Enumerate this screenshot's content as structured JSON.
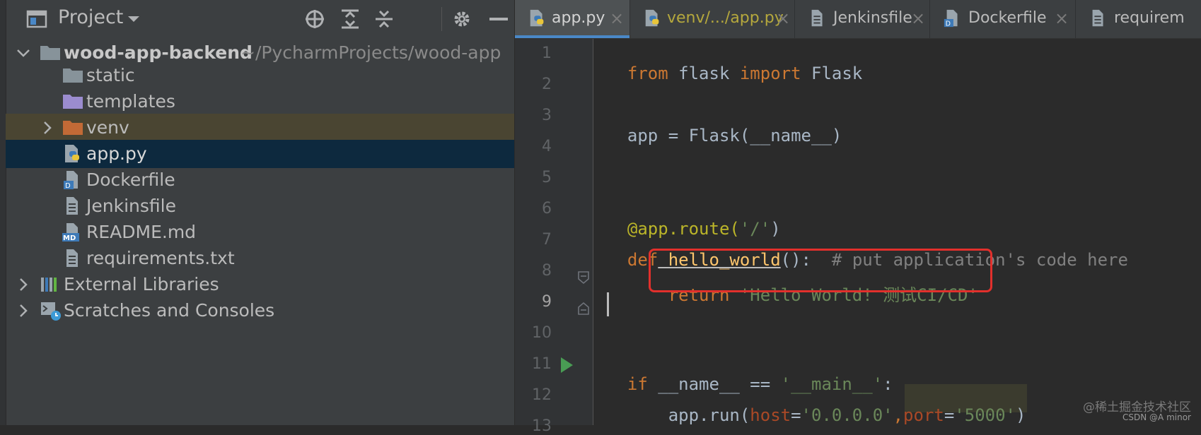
{
  "project_panel": {
    "title": "Project",
    "header_icons": [
      "locate-icon",
      "expand-all-icon",
      "collapse-all-icon",
      "gear-icon",
      "hide-icon"
    ],
    "root": {
      "name": "wood-app-backend",
      "path": "~/PycharmProjects/wood-app"
    },
    "items": [
      {
        "label": "static",
        "icon": "folder-icon"
      },
      {
        "label": "templates",
        "icon": "folder-purple-icon"
      },
      {
        "label": "venv",
        "icon": "folder-orange-icon"
      },
      {
        "label": "app.py",
        "icon": "python-file-icon"
      },
      {
        "label": "Dockerfile",
        "icon": "docker-file-icon"
      },
      {
        "label": "Jenkinsfile",
        "icon": "text-file-icon"
      },
      {
        "label": "README.md",
        "icon": "markdown-file-icon"
      },
      {
        "label": "requirements.txt",
        "icon": "text-file-icon"
      }
    ],
    "external_libraries": "External Libraries",
    "scratches": "Scratches and Consoles"
  },
  "tabs": [
    {
      "label": "app.py",
      "active": true
    },
    {
      "label": "venv/.../app.py",
      "active": false
    },
    {
      "label": "Jenkinsfile",
      "active": false
    },
    {
      "label": "Dockerfile",
      "active": false
    },
    {
      "label": "requirem",
      "active": false
    }
  ],
  "editor": {
    "line_numbers": [
      "1",
      "2",
      "3",
      "4",
      "5",
      "6",
      "7",
      "8",
      "9",
      "10",
      "11",
      "12",
      "13"
    ],
    "current_line": 9,
    "code": {
      "l1": {
        "kw1": "from",
        "mod": " flask ",
        "kw2": "import",
        "cls": " Flask"
      },
      "l3": {
        "text": "app = Flask(__name__)"
      },
      "l6": {
        "deco": "@app.route(",
        "str": "'/'",
        "end": ")"
      },
      "l7": {
        "kw": "def",
        "fn": " hello_world",
        "paren": "():",
        "cmt": "  # put application's code here"
      },
      "l8": {
        "indent": "    ",
        "kw": "return",
        "str": " 'Hello World! 测试CI/CD'"
      },
      "l11": {
        "kw": "if",
        "mid": " __name__ == ",
        "str": "'__main__'",
        "end": ":"
      },
      "l12": {
        "indent": "    ",
        "call": "app.run(",
        "p1": "host",
        "eq1": "=",
        "v1": "'0.0.0.0'",
        "comma": ",",
        "p2": "port",
        "eq2": "=",
        "v2": "'5000'",
        "end": ")"
      }
    }
  },
  "watermark": "@稀土掘金技术社区",
  "watermark_sub": "CSDN @A minor",
  "colors": {
    "keyword": "#cc7832",
    "string": "#6a8759",
    "decorator": "#bbb529",
    "comment": "#808080",
    "highlight_box": "#e2302c",
    "selection": "#0d293e"
  }
}
